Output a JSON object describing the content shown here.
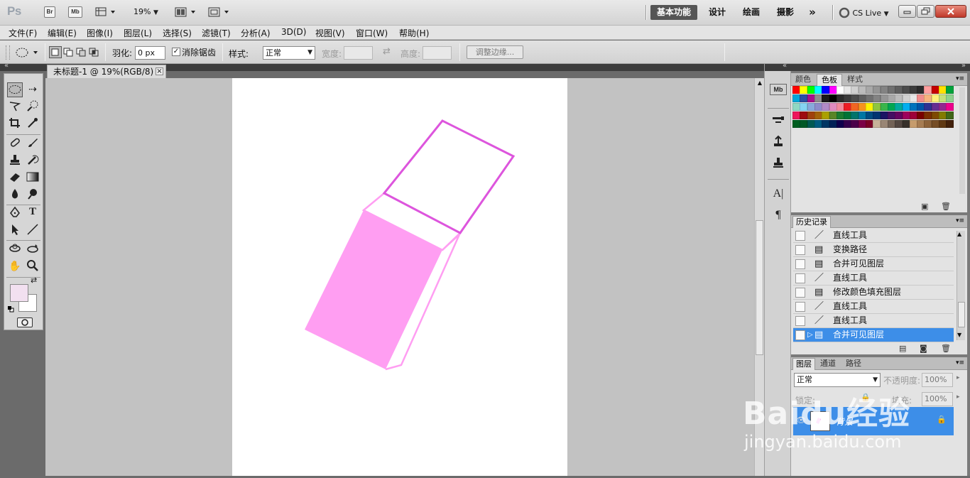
{
  "app": {
    "logo": "Ps",
    "bridge_btn": "Br",
    "minibridge_btn": "Mb",
    "zoom": "19%",
    "workspaces": [
      "基本功能",
      "设计",
      "绘画",
      "摄影"
    ],
    "workspace_more": "»",
    "cslive": "CS Live"
  },
  "menu": [
    "文件(F)",
    "编辑(E)",
    "图像(I)",
    "图层(L)",
    "选择(S)",
    "滤镜(T)",
    "分析(A)",
    "3D(D)",
    "视图(V)",
    "窗口(W)",
    "帮助(H)"
  ],
  "options": {
    "feather_label": "羽化:",
    "feather_value": "0 px",
    "antialias_label": "消除锯齿",
    "style_label": "样式:",
    "style_value": "正常",
    "width_label": "宽度:",
    "height_label": "高度:",
    "refine_edge": "调整边缘..."
  },
  "document": {
    "tab_title": "未标题-1 @ 19%(RGB/8) *",
    "close": "×"
  },
  "colors": {
    "eraser_fill": "#ff9ef2",
    "eraser_stroke": "#dd55dd",
    "highlight": "#3d8ee8",
    "foreground": "#f2e0f0",
    "background": "#ffffff"
  },
  "swatch_panel": {
    "tabs": [
      "颜色",
      "色板",
      "样式"
    ],
    "active_tab": "色板",
    "swatches": [
      "#ff0000",
      "#ffff00",
      "#00ff00",
      "#00ffff",
      "#0000ff",
      "#ff00ff",
      "#ffffff",
      "#e6e6e6",
      "#d0d0d0",
      "#bcbcbc",
      "#a8a8a8",
      "#959595",
      "#838383",
      "#707070",
      "#5e5e5e",
      "#4c4c4c",
      "#3b3b3b",
      "#2a2a2a",
      "#ff9f9f",
      "#c60000",
      "#ffe100",
      "#00a33b",
      "#00a6d8",
      "#2b4fa4",
      "#a8108c",
      "#8c8c8c",
      "#1a1a1a",
      "#000000",
      "#2a2a2a",
      "#3b3b3b",
      "#4c4c4c",
      "#5e5e5e",
      "#707070",
      "#838383",
      "#959595",
      "#a8a8a8",
      "#bcbcbc",
      "#d0d0d0",
      "#e6e6e6",
      "#f08c8c",
      "#f7b37e",
      "#fff17a",
      "#c5e07a",
      "#8ed28f",
      "#8fd8c3",
      "#85d4f2",
      "#89a9dc",
      "#8d8bcb",
      "#b18bc7",
      "#e08bbf",
      "#f18a9c",
      "#ed1c24",
      "#f26522",
      "#f7941d",
      "#fff200",
      "#8dc63f",
      "#39b54a",
      "#00a651",
      "#00a99d",
      "#00aeef",
      "#0072bc",
      "#0054a6",
      "#2e3192",
      "#662d91",
      "#92278f",
      "#ec008c",
      "#ed145b",
      "#9e0b0f",
      "#a0410d",
      "#a36209",
      "#aba000",
      "#598527",
      "#1a7b30",
      "#007236",
      "#00746b",
      "#0076a3",
      "#004b80",
      "#003471",
      "#1b1464",
      "#440e62",
      "#630460",
      "#9e005d",
      "#9e0039",
      "#790000",
      "#7b2e00",
      "#7d4900",
      "#827b00",
      "#406618",
      "#005e20",
      "#005826",
      "#005952",
      "#005b7f",
      "#003663",
      "#002157",
      "#0d004c",
      "#32004b",
      "#4b0049",
      "#7b0046",
      "#7a0026",
      "#c7b299",
      "#998675",
      "#736357",
      "#534741",
      "#37302a",
      "#c69c6d",
      "#a67c52",
      "#8c6239",
      "#754c24",
      "#603913",
      "#42210b"
    ]
  },
  "history_panel": {
    "title": "历史记录",
    "items": [
      {
        "icon": "line-tool-icon",
        "label": "直线工具"
      },
      {
        "icon": "history-doc-icon",
        "label": "变换路径"
      },
      {
        "icon": "history-doc-icon",
        "label": "合并可见图层"
      },
      {
        "icon": "line-tool-icon",
        "label": "直线工具"
      },
      {
        "icon": "history-doc-icon",
        "label": "修改颜色填充图层"
      },
      {
        "icon": "line-tool-icon",
        "label": "直线工具"
      },
      {
        "icon": "line-tool-icon",
        "label": "直线工具"
      },
      {
        "icon": "history-doc-icon",
        "label": "合并可见图层"
      }
    ],
    "selected_index": 7
  },
  "layers_panel": {
    "tabs": [
      "图层",
      "通道",
      "路径"
    ],
    "blend_mode": "正常",
    "opacity_label": "不透明度:",
    "opacity_value": "100%",
    "lock_label": "锁定:",
    "fill_label": "填充:",
    "fill_value": "100%",
    "layer_name": "背景"
  },
  "watermark": {
    "brand": "Baidu经验",
    "url": "jingyan.baidu.com"
  }
}
